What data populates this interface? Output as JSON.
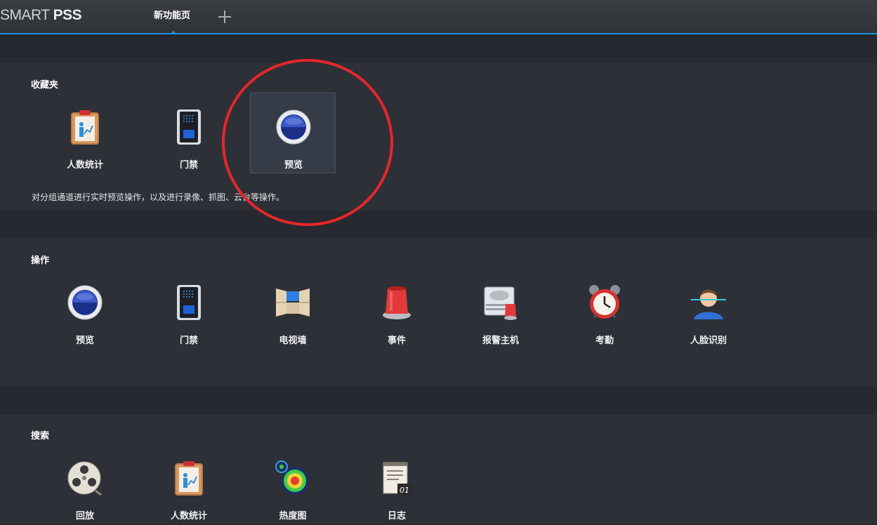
{
  "app": {
    "logo_thin": "SMART ",
    "logo_bold": "PSS"
  },
  "tabs": [
    {
      "label": "新功能页"
    }
  ],
  "favorites": {
    "title": "收藏夹",
    "items": [
      {
        "label": "人数统计",
        "icon": "people-count-icon"
      },
      {
        "label": "门禁",
        "icon": "access-control-icon"
      },
      {
        "label": "预览",
        "icon": "preview-icon",
        "selected": true
      }
    ],
    "description": "对分组通道进行实时预览操作，以及进行录像、抓图、云台等操作。"
  },
  "operations": {
    "title": "操作",
    "items": [
      {
        "label": "预览",
        "icon": "preview-icon"
      },
      {
        "label": "门禁",
        "icon": "access-control-icon"
      },
      {
        "label": "电视墙",
        "icon": "video-wall-icon"
      },
      {
        "label": "事件",
        "icon": "event-alarm-icon"
      },
      {
        "label": "报警主机",
        "icon": "alarm-host-icon"
      },
      {
        "label": "考勤",
        "icon": "alarm-clock-icon"
      },
      {
        "label": "人脸识别",
        "icon": "face-recognition-icon"
      }
    ]
  },
  "search": {
    "title": "搜索",
    "items": [
      {
        "label": "回放",
        "icon": "playback-reel-icon"
      },
      {
        "label": "人数统计",
        "icon": "people-count-icon"
      },
      {
        "label": "热度图",
        "icon": "heatmap-icon"
      },
      {
        "label": "日志",
        "icon": "log-icon"
      }
    ]
  },
  "colors": {
    "accent": "#1f8fd8",
    "annotation": "#e5262a"
  }
}
